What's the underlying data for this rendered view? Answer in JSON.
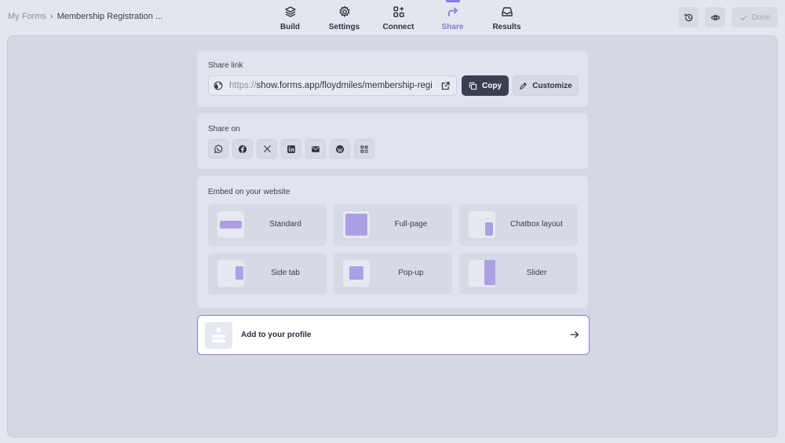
{
  "breadcrumb": {
    "root": "My Forms",
    "separator": "›",
    "current": "Membership Registration ..."
  },
  "tabs": [
    {
      "label": "Build",
      "icon": "layers-icon",
      "active": false
    },
    {
      "label": "Settings",
      "icon": "gear-icon",
      "active": false
    },
    {
      "label": "Connect",
      "icon": "connect-icon",
      "active": false
    },
    {
      "label": "Share",
      "icon": "share-icon",
      "active": true
    },
    {
      "label": "Results",
      "icon": "inbox-icon",
      "active": false
    }
  ],
  "actions": {
    "history_icon": "history-icon",
    "preview_icon": "eye-icon",
    "done_label": "Done"
  },
  "share_link": {
    "title": "Share link",
    "protocol": "https://",
    "url": "show.forms.app/floydmiles/membership-registration",
    "copy_label": "Copy",
    "customize_label": "Customize"
  },
  "share_on": {
    "title": "Share on",
    "networks": [
      "whatsapp-icon",
      "facebook-icon",
      "x-icon",
      "linkedin-icon",
      "email-icon",
      "wordpress-icon",
      "qr-code-icon"
    ]
  },
  "embed": {
    "title": "Embed on your website",
    "options": [
      "Standard",
      "Full-page",
      "Chatbox layout",
      "Side tab",
      "Pop-up",
      "Slider"
    ]
  },
  "profile": {
    "label": "Add to your profile"
  },
  "colors": {
    "accent": "#8a7ae0",
    "dark_button": "#3b3f52",
    "thumb_fill": "#ad9fe6"
  }
}
